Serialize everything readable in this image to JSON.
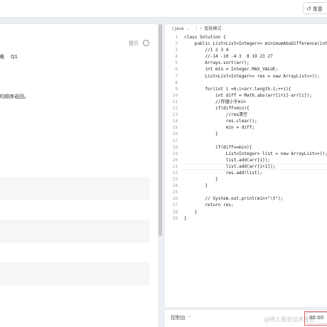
{
  "toolbar": {
    "reset_label": "重置"
  },
  "problem": {
    "hint_label": "提示",
    "fragment_1": "难",
    "fragment_1b": "Q1",
    "fragment_2": "的顺序返回。"
  },
  "editor": {
    "language": "Java",
    "mode": "智能模式",
    "lines": [
      "class Solution {",
      "    public List<List<Integer>> minimumAbsDifference(int[] arr) {",
      "        //1 2 3 4",
      "        //-14 -10 -4 3  8 19 23 27",
      "        Arrays.sort(arr);",
      "        int min = Integer.MAX_VALUE;",
      "        List<List<Integer>> res = new ArrayList<>();",
      "",
      "        for(int i =0;i<arr.length-1;++i){",
      "            int diff = Math.abs(arr[i+1]-arr[i]);",
      "            //存值小于min",
      "            if(diff<min){",
      "                //res清空",
      "                res.clear();",
      "                min = diff;",
      "            }",
      "",
      "            if(diff==min){",
      "                List<Integer> list = new ArrayList<>();",
      "                list.add(arr[i]);",
      "                list.add(arr[i+1]);",
      "                res.add(list);",
      "            }",
      "        }",
      "",
      "        // System.out.print(min+\"\\t\");",
      "        return res;",
      "    }",
      "}"
    ]
  },
  "bottom": {
    "console_label": "控制台",
    "watermark": "@稀土掘金技术社区",
    "run_label": "00:00"
  }
}
